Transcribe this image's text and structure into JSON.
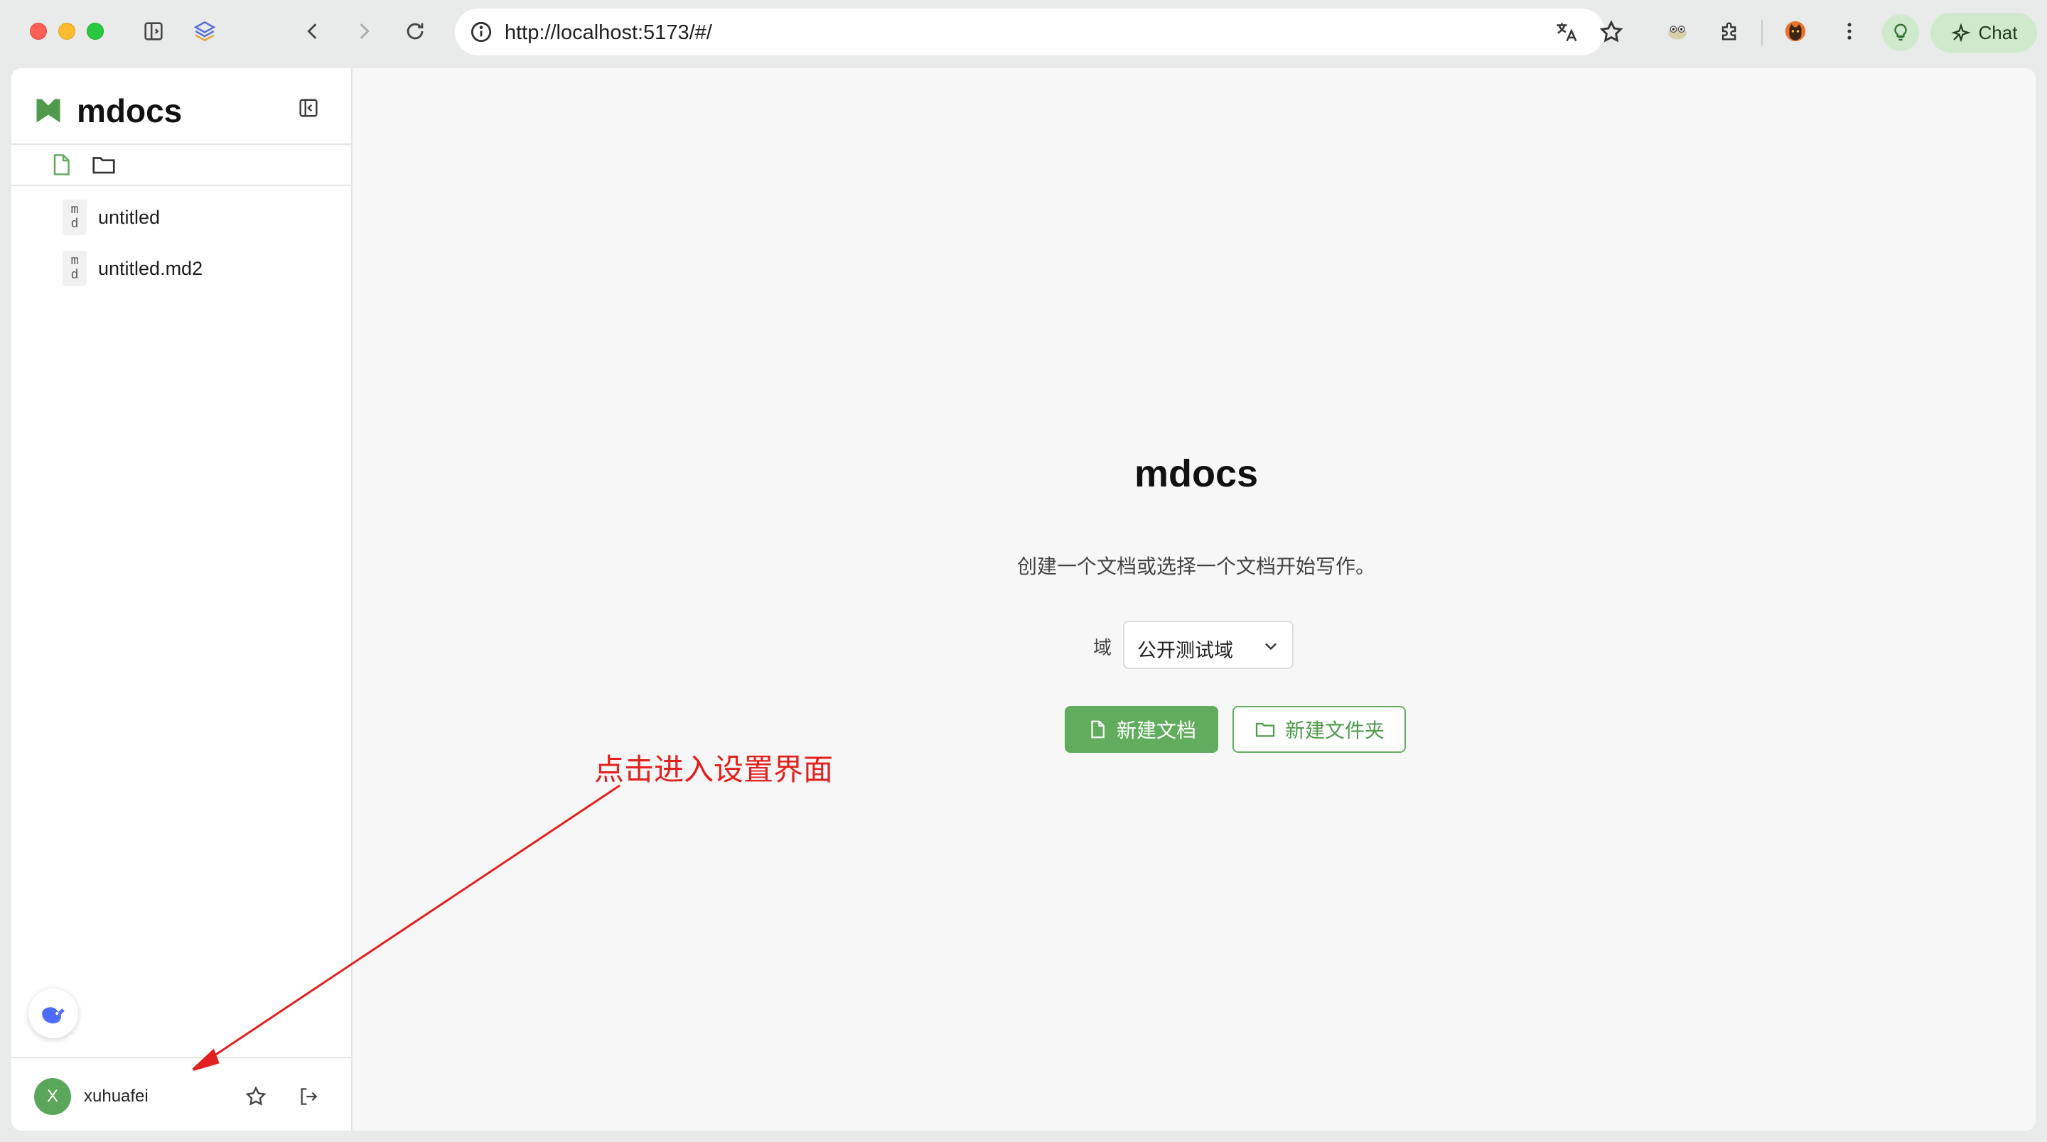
{
  "browser": {
    "url": "http://localhost:5173/#/",
    "chat_label": "Chat"
  },
  "sidebar": {
    "brand": "mdocs",
    "files": [
      {
        "icon_top": "m",
        "icon_bottom": "d",
        "name": "untitled"
      },
      {
        "icon_top": "m",
        "icon_bottom": "d",
        "name": "untitled.md2"
      }
    ],
    "user": {
      "avatar_letter": "X",
      "name": "xuhuafei"
    }
  },
  "main": {
    "title": "mdocs",
    "subtitle": "创建一个文档或选择一个文档开始写作。",
    "domain_label": "域",
    "domain_value": "公开测试域",
    "new_doc_label": "新建文档",
    "new_folder_label": "新建文件夹"
  },
  "annotation": {
    "text": "点击进入设置界面"
  },
  "colors": {
    "accent_green": "#62ac5e",
    "annotation_red": "#e1211d"
  },
  "icons": [
    "sidebar-toggle-icon",
    "layers-icon",
    "back-icon",
    "forward-icon",
    "reload-icon",
    "info-icon",
    "translate-icon",
    "bookmark-star-icon",
    "frog-extension-icon",
    "puzzle-extension-icon",
    "cat-extension-icon",
    "kebab-menu-icon",
    "lightbulb-icon",
    "sparkle-icon",
    "flag-logo-icon",
    "collapse-sidebar-icon",
    "new-file-icon",
    "new-folder-icon",
    "deepseek-icon",
    "star-icon",
    "logout-icon",
    "chevron-down-icon"
  ]
}
